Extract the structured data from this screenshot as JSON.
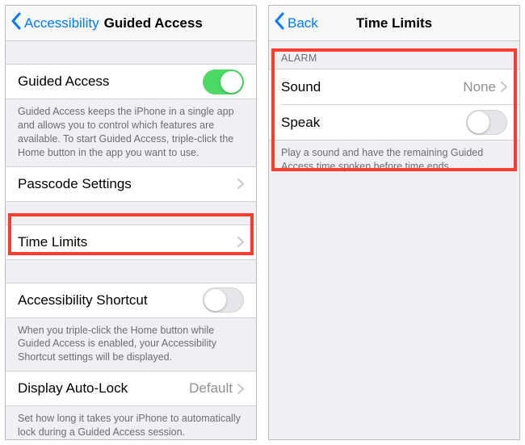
{
  "left": {
    "back_label": "Accessibility",
    "title": "Guided Access",
    "guided_access": {
      "label": "Guided Access",
      "footer": "Guided Access keeps the iPhone in a single app and allows you to control which features are available. To start Guided Access, triple-click the Home button in the app you want to use."
    },
    "passcode": {
      "label": "Passcode Settings"
    },
    "time_limits": {
      "label": "Time Limits"
    },
    "shortcut": {
      "label": "Accessibility Shortcut",
      "footer": "When you triple-click the Home button while Guided Access is enabled, your Accessibility Shortcut settings will be displayed."
    },
    "autolock": {
      "label": "Display Auto-Lock",
      "value": "Default",
      "footer": "Set how long it takes your iPhone to automatically lock during a Guided Access session."
    }
  },
  "right": {
    "back_label": "Back",
    "title": "Time Limits",
    "alarm_header": "ALARM",
    "sound": {
      "label": "Sound",
      "value": "None"
    },
    "speak": {
      "label": "Speak"
    },
    "footer": "Play a sound and have the remaining Guided Access time spoken before time ends."
  }
}
